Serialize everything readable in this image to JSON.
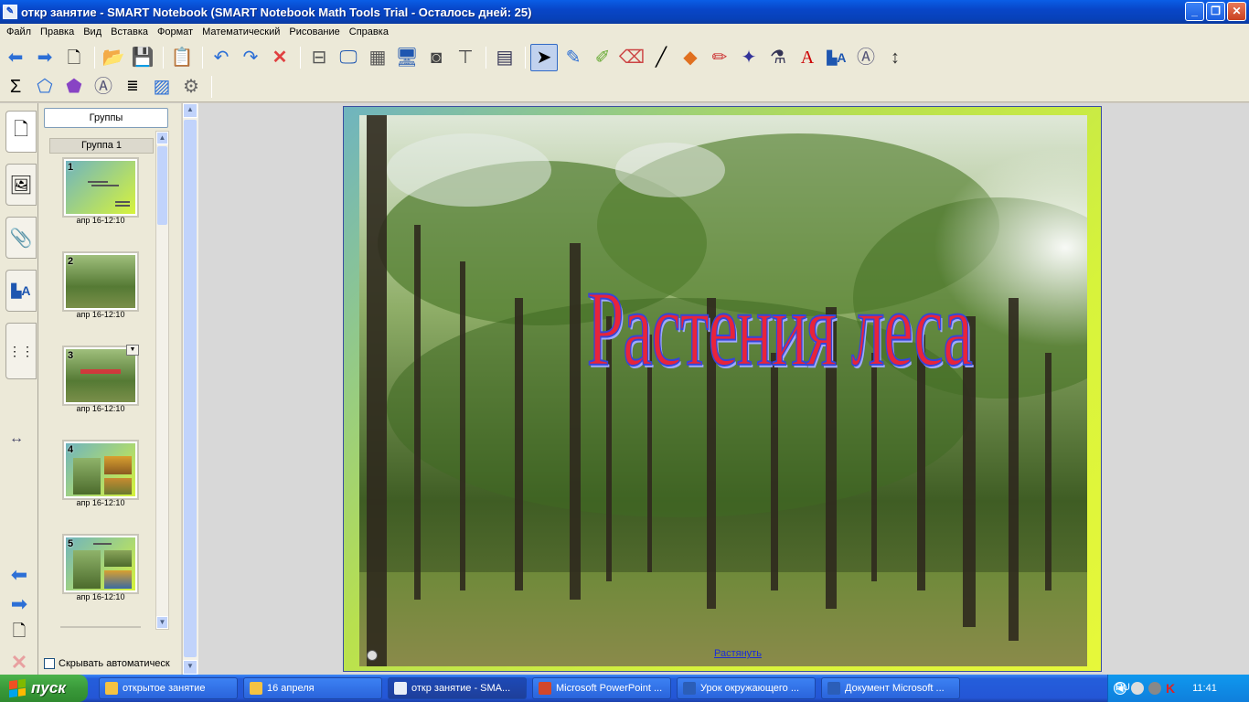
{
  "window": {
    "title": "откр занятие - SMART Notebook (SMART Notebook Math Tools Trial - Осталось дней: 25)",
    "app_icon": "notebook-app-icon"
  },
  "menu": [
    "Файл",
    "Правка",
    "Вид",
    "Вставка",
    "Формат",
    "Математический",
    "Рисование",
    "Справка"
  ],
  "toolbar_row1": [
    "back-arrow-icon",
    "forward-arrow-icon",
    "new-page-icon",
    "open-folder-icon",
    "save-icon",
    "paste-icon",
    "undo-icon",
    "redo-icon",
    "delete-icon",
    "screen-shade-icon",
    "fullscreen-icon",
    "transparent-bg-icon",
    "dual-page-icon",
    "screen-capture-icon",
    "document-camera-icon",
    "table-icon",
    "select-arrow-icon",
    "pen-icon",
    "creative-pen-icon",
    "eraser-icon",
    "line-icon",
    "shapes-icon",
    "magic-pen-icon",
    "shape-recognition-pen-icon",
    "fill-icon",
    "text-icon",
    "properties-icon",
    "measurement-tools-icon",
    "toolbar-move-icon"
  ],
  "toolbar_row2": [
    "sigma-icon",
    "polygon-icon",
    "shape-3d-icon",
    "compass-icon",
    "equation-icon",
    "graph-icon",
    "math-tools-icon"
  ],
  "sidebar_tabs": [
    "page-sorter-icon",
    "gallery-icon",
    "attachments-icon",
    "properties-tab-icon",
    "addons-tab-icon"
  ],
  "panel": {
    "groups_button": "Группы",
    "group_header": "Группа 1",
    "thumbnails": [
      {
        "num": "1",
        "date": "апр 16-12:10"
      },
      {
        "num": "2",
        "date": "апр 16-12:10"
      },
      {
        "num": "3",
        "date": "апр 16-12:10"
      },
      {
        "num": "4",
        "date": "апр 16-12:10"
      },
      {
        "num": "5",
        "date": "апр 16-12:10"
      }
    ],
    "autohide_label": "Скрывать автоматическ"
  },
  "slide": {
    "title": "Растения леса",
    "stretch_link": "Растянуть",
    "title_color": "#e8243a",
    "outline_color": "#3646d8"
  },
  "taskbar": {
    "start": "пуск",
    "tasks": [
      {
        "label": "открытое занятие",
        "icon": "folder-icon",
        "color": "#f5c342"
      },
      {
        "label": "16 апреля",
        "icon": "folder-icon",
        "color": "#f5c342"
      },
      {
        "label": "откр занятие - SMA...",
        "icon": "notebook-app-icon",
        "color": "#e8eef8",
        "active": true
      },
      {
        "label": "Microsoft PowerPoint ...",
        "icon": "powerpoint-icon",
        "color": "#d2472a"
      },
      {
        "label": "Урок окружающего ...",
        "icon": "word-icon",
        "color": "#2b5eb8"
      },
      {
        "label": "Документ Microsoft ...",
        "icon": "word-icon",
        "color": "#2b5eb8"
      }
    ],
    "lang": "RU",
    "clock": "11:41"
  }
}
